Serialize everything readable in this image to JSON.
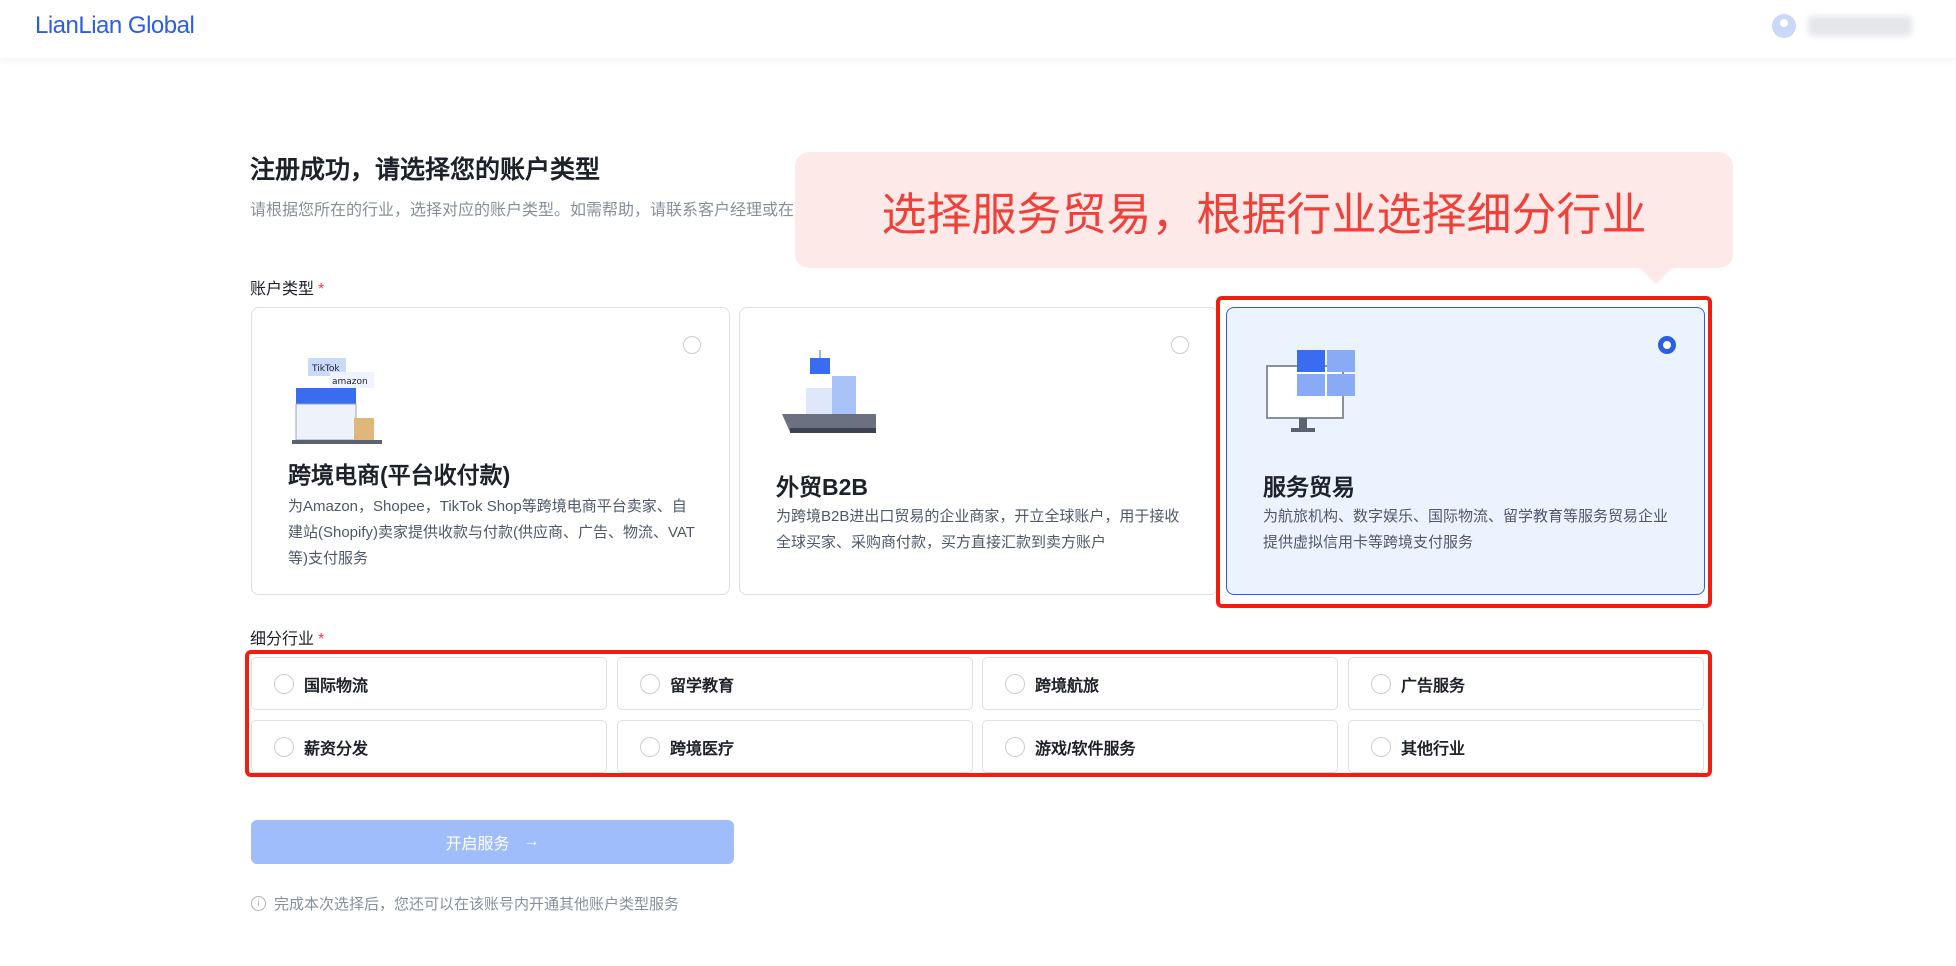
{
  "header": {
    "logo": "LianLian Global"
  },
  "page": {
    "title": "注册成功，请选择您的账户类型",
    "subtitle": "请根据您所在的行业，选择对应的账户类型。如需帮助，请联系客户经理或在"
  },
  "callout": {
    "text": "选择服务贸易，根据行业选择细分行业"
  },
  "account_type": {
    "label": "账户类型",
    "required": "*",
    "cards": [
      {
        "title": "跨境电商(平台收付款)",
        "desc": "为Amazon，Shopee，TikTok Shop等跨境电商平台卖家、自建站(Shopify)卖家提供收款与付款(供应商、广告、物流、VAT等)支付服务",
        "selected": false,
        "badges": [
          "TikTok",
          "amazon"
        ]
      },
      {
        "title": "外贸B2B",
        "desc": "为跨境B2B进出口贸易的企业商家，开立全球账户，用于接收全球买家、采购商付款，买方直接汇款到卖方账户",
        "selected": false
      },
      {
        "title": "服务贸易",
        "desc": "为航旅机构、数字娱乐、国际物流、留学教育等服务贸易企业提供虚拟信用卡等跨境支付服务",
        "selected": true
      }
    ]
  },
  "industry": {
    "label": "细分行业",
    "required": "*",
    "options": [
      "国际物流",
      "留学教育",
      "跨境航旅",
      "广告服务",
      "薪资分发",
      "跨境医疗",
      "游戏/软件服务",
      "其他行业"
    ]
  },
  "submit": {
    "label": "开启服务",
    "arrow": "→"
  },
  "note": {
    "icon": "i",
    "text": "完成本次选择后，您还可以在该账号内开通其他账户类型服务"
  },
  "colors": {
    "primary": "#2a5ee6",
    "annotation": "#f41c0f",
    "callout_bg": "#fde9e7"
  }
}
